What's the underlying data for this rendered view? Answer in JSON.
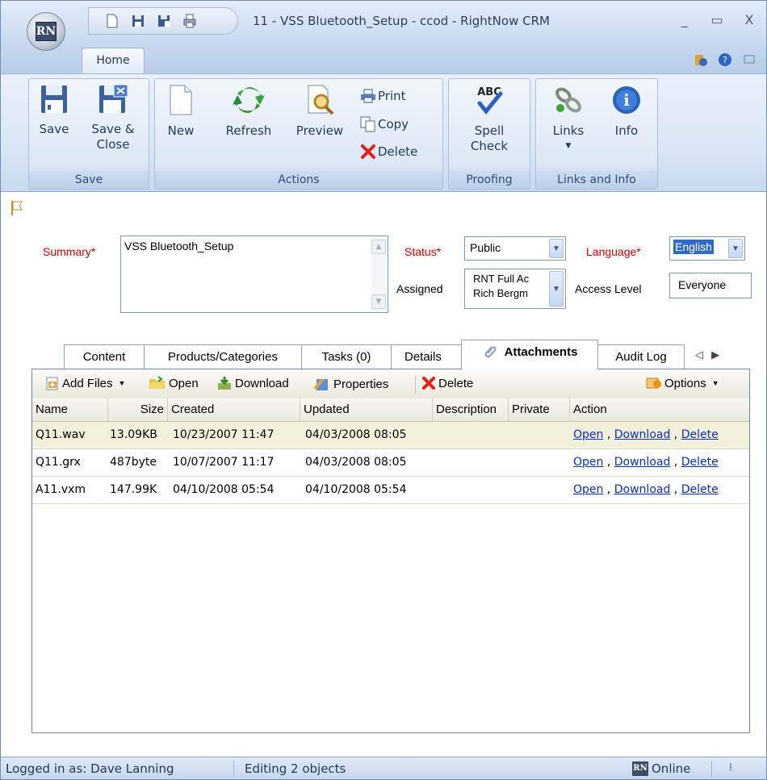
{
  "window": {
    "title": "11 - VSS Bluetooth_Setup  - ccod - RightNow CRM",
    "logo_text": "RN"
  },
  "ribbon_tab": "Home",
  "ribbon": {
    "save_group": {
      "label": "Save",
      "save": "Save",
      "save_close_line1": "Save &",
      "save_close_line2": "Close"
    },
    "actions_group": {
      "label": "Actions",
      "new": "New",
      "refresh": "Refresh",
      "preview": "Preview",
      "print": "Print",
      "copy": "Copy",
      "delete": "Delete"
    },
    "proofing_group": {
      "label": "Proofing",
      "spell_line1": "Spell",
      "spell_line2": "Check",
      "abc": "ABC"
    },
    "links_group": {
      "label": "Links and Info",
      "links": "Links",
      "info": "Info"
    }
  },
  "form": {
    "summary_label": "Summary*",
    "summary_value": "VSS Bluetooth_Setup",
    "status_label": "Status*",
    "status_value": "Public",
    "language_label": "Language*",
    "language_value": "English",
    "assigned_label": "Assigned",
    "assigned_line1": "RNT Full Ac",
    "assigned_line2": "Rich Bergm",
    "access_label": "Access Level",
    "access_value": "Everyone"
  },
  "tabs": [
    {
      "label": "Content"
    },
    {
      "label": "Products/Categories"
    },
    {
      "label": "Tasks (0)"
    },
    {
      "label": "Details"
    },
    {
      "label": "Attachments"
    },
    {
      "label": "Audit Log"
    }
  ],
  "toolbar": {
    "add_files": "Add Files",
    "open": "Open",
    "download": "Download",
    "properties": "Properties",
    "delete": "Delete",
    "options": "Options"
  },
  "columns": [
    "Name",
    "Size",
    "Created",
    "Updated",
    "Description",
    "Private",
    "Action"
  ],
  "rows": [
    {
      "name": "Q11.wav",
      "size": "13.09KB",
      "created": "10/23/2007 11:47",
      "updated": "04/03/2008 08:05",
      "open": "Open",
      "download": "Download",
      "delete": "Delete"
    },
    {
      "name": "Q11.grx",
      "size": "487byte",
      "created": "10/07/2007 11:17",
      "updated": "04/03/2008 08:05",
      "open": "Open",
      "download": "Download",
      "delete": "Delete"
    },
    {
      "name": "A11.vxm",
      "size": "147.99K",
      "created": "04/10/2008 05:54",
      "updated": "04/10/2008 05:54",
      "open": "Open",
      "download": "Download",
      "delete": "Delete"
    }
  ],
  "status_bar": {
    "logged_in": "Logged in as: Dave Lanning",
    "editing": "Editing 2 objects",
    "online": "Online",
    "online_logo": "RN"
  }
}
